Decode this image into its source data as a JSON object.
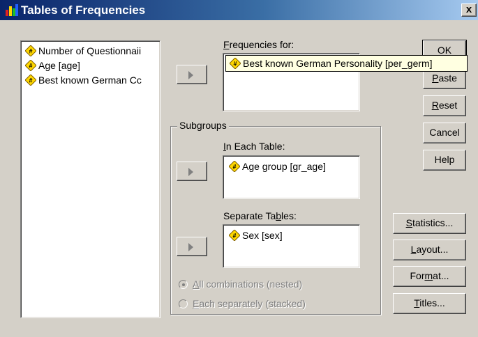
{
  "window": {
    "title": "Tables of Frequencies",
    "close_label": "x"
  },
  "source_list": {
    "items": [
      {
        "label": "Number of Questionnaii",
        "icon": "numeric-variable-icon"
      },
      {
        "label": "Age [age]",
        "icon": "numeric-variable-icon"
      },
      {
        "label": "Best known German Cc",
        "icon": "numeric-variable-icon"
      }
    ]
  },
  "frequencies": {
    "label_accel": "F",
    "label_rest": "requencies for:",
    "item": "Best known German Personality [per_germ]"
  },
  "subgroups": {
    "title": "Subgroups",
    "each_label_accel": "I",
    "each_label_rest": "n Each Table:",
    "each_item": "Age group [gr_age]",
    "sep_label_pre": "Separate Ta",
    "sep_label_accel": "b",
    "sep_label_post": "les:",
    "sep_item": "Sex [sex]",
    "radio_all_accel": "A",
    "radio_all_rest": "ll combinations (nested)",
    "radio_each_accel": "E",
    "radio_each_rest": "ach separately (stacked)"
  },
  "buttons": {
    "ok": "OK",
    "paste_accel": "P",
    "paste_rest": "aste",
    "reset_accel": "R",
    "reset_rest": "eset",
    "cancel": "Cancel",
    "help": "Help",
    "statistics_accel": "S",
    "statistics_rest": "tatistics...",
    "layout_accel": "L",
    "layout_rest": "ayout...",
    "format_pre": "For",
    "format_accel": "m",
    "format_post": "at...",
    "titles_accel": "T",
    "titles_rest": "itles..."
  },
  "colors": {
    "titlebar_start": "#0a246a",
    "titlebar_end": "#a6caf0",
    "dialog_face": "#d4d0c8",
    "icon_fill": "#ffd700",
    "tooltip_bg": "#ffffe1"
  }
}
